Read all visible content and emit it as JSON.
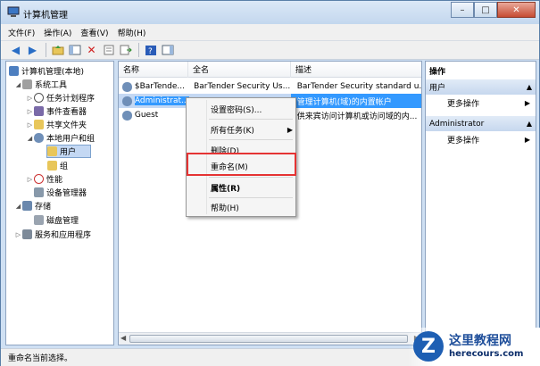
{
  "window": {
    "title": "计算机管理"
  },
  "window_buttons": {
    "minimize": "–",
    "maximize": "□",
    "close": "✕"
  },
  "menu": [
    "文件(F)",
    "操作(A)",
    "查看(V)",
    "帮助(H)"
  ],
  "tree": {
    "root": "计算机管理(本地)",
    "system_tools": "系统工具",
    "task_scheduler": "任务计划程序",
    "event_viewer": "事件查看器",
    "shared_folders": "共享文件夹",
    "local_users": "本地用户和组",
    "users": "用户",
    "groups": "组",
    "performance": "性能",
    "device_manager": "设备管理器",
    "storage": "存储",
    "disk_management": "磁盘管理",
    "services": "服务和应用程序"
  },
  "list": {
    "columns": [
      "名称",
      "全名",
      "描述"
    ],
    "rows": [
      {
        "name": "$BarTende...",
        "fullname": "BarTender Security Us...",
        "desc": "BarTender Security standard u..."
      },
      {
        "name": "Administrat...",
        "fullname": "",
        "desc": "管理计算机(域)的内置帐户"
      },
      {
        "name": "Guest",
        "fullname": "",
        "desc": "供来宾访问计算机或访问域的内..."
      }
    ]
  },
  "context_menu": {
    "set_password": "设置密码(S)...",
    "all_tasks": "所有任务(K)",
    "delete": "删除(D)",
    "rename": "重命名(M)",
    "properties": "属性(R)",
    "help": "帮助(H)"
  },
  "actions": {
    "header": "操作",
    "group1": "用户",
    "more1": "更多操作",
    "group2": "Administrator",
    "more2": "更多操作"
  },
  "status": "重命名当前选择。",
  "watermark": {
    "logo": "Z",
    "line1": "这里教程网",
    "line2": "herecours.com"
  },
  "colors": {
    "selection": "#3399ff",
    "highlight_box": "#e53333",
    "title_bar": "#c3d7ee"
  }
}
